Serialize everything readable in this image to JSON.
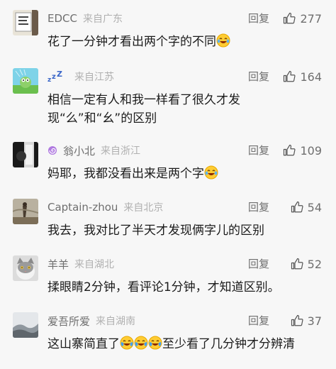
{
  "comments": [
    {
      "username": "EDCC",
      "location": "来自广东",
      "reply": "回复",
      "likes": "277",
      "text_before": "花了一分钟才看出两个字的不同",
      "emoji_count": 1,
      "text_after": ""
    },
    {
      "username": "",
      "location": "来自江苏",
      "reply": "回复",
      "likes": "164",
      "text_before": "相信一定有人和我一样看了很久才发现“么”和“幺”的区别",
      "emoji_count": 0,
      "text_after": ""
    },
    {
      "username": "翁小北",
      "location": "来自浙江",
      "reply": "回复",
      "likes": "109",
      "text_before": "妈耶，我都没看出来是两个字",
      "emoji_count": 1,
      "text_after": ""
    },
    {
      "username": "Captain-zhou",
      "location": "来自北京",
      "reply": "回复",
      "likes": "54",
      "text_before": "我去，我对比了半天才发现俩字儿的区别",
      "emoji_count": 0,
      "text_after": ""
    },
    {
      "username": "羊羊",
      "location": "来自湖北",
      "reply": "回复",
      "likes": "52",
      "text_before": "揉眼睛2分钟，看评论1分钟，才知道区别。",
      "emoji_count": 0,
      "text_after": ""
    },
    {
      "username": "爱吾所爱",
      "location": "来自湖南",
      "reply": "回复",
      "likes": "37",
      "text_before": "这山寨简直了",
      "emoji_count": 3,
      "text_after": "至少看了几分钟才分辨清"
    }
  ]
}
